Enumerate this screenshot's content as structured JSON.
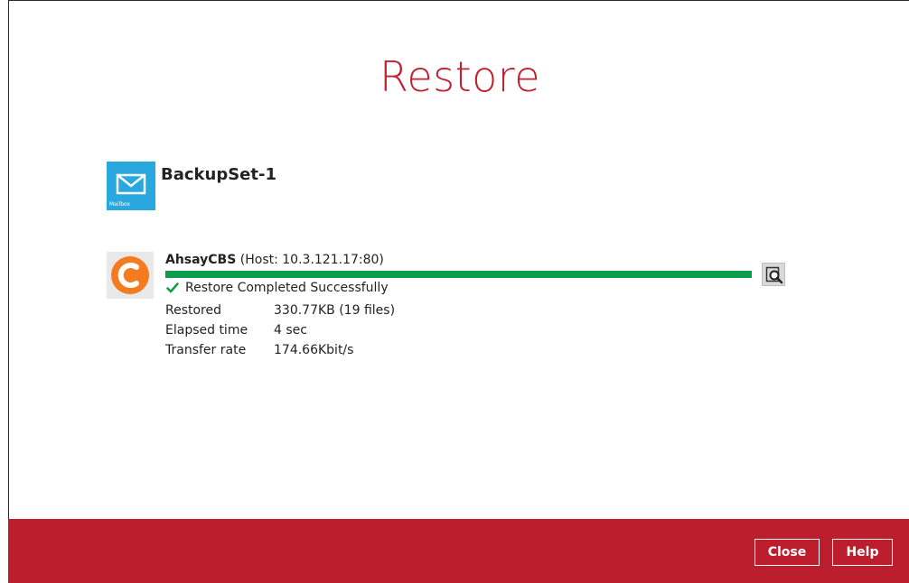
{
  "title": "Restore",
  "backupset": {
    "name": "BackupSet-1",
    "icon": "mailbox-icon",
    "icon_label": "Mailbox",
    "icon_color": "#29a8e0"
  },
  "destination": {
    "name": "AhsayCBS",
    "host": "(Host: 10.3.121.17:80)",
    "icon": "ahsay-logo-icon",
    "progress": 1.0,
    "progress_color": "#0f9c4b",
    "status": "Restore Completed Successfully",
    "stats": [
      {
        "label": "Restored",
        "value": "330.77KB (19 files)"
      },
      {
        "label": "Elapsed time",
        "value": "4 sec"
      },
      {
        "label": "Transfer rate",
        "value": "174.66Kbit/s"
      }
    ]
  },
  "footer": {
    "close_label": "Close",
    "help_label": "Help",
    "background": "#bc1e2d"
  },
  "colors": {
    "title": "#c0202f",
    "success": "#0f9c4b"
  }
}
